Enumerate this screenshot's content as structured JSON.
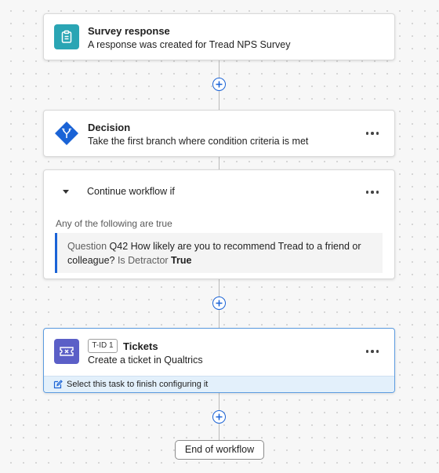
{
  "trigger": {
    "icon": "clipboard-icon",
    "color": "#2aa5b4",
    "title": "Survey response",
    "subtitle": "A response was created for Tread NPS Survey"
  },
  "decision": {
    "icon": "branch-icon",
    "color": "#1a63d6",
    "title": "Decision",
    "subtitle": "Take the first branch where condition criteria is met"
  },
  "branch": {
    "label": "Continue workflow if",
    "match_text": "Any of the following are true",
    "condition": {
      "prefix": "Question",
      "question": "Q42 How likely are you to recommend Tread to a friend or colleague?",
      "operator": "Is Detractor",
      "value": "True"
    }
  },
  "task": {
    "icon": "ticket-icon",
    "color": "#5b5fc7",
    "badge": "T-ID 1",
    "title": "Tickets",
    "subtitle": "Create a ticket in Qualtrics",
    "config_hint": "Select this task to finish configuring it"
  },
  "end": {
    "label": "End of workflow"
  }
}
